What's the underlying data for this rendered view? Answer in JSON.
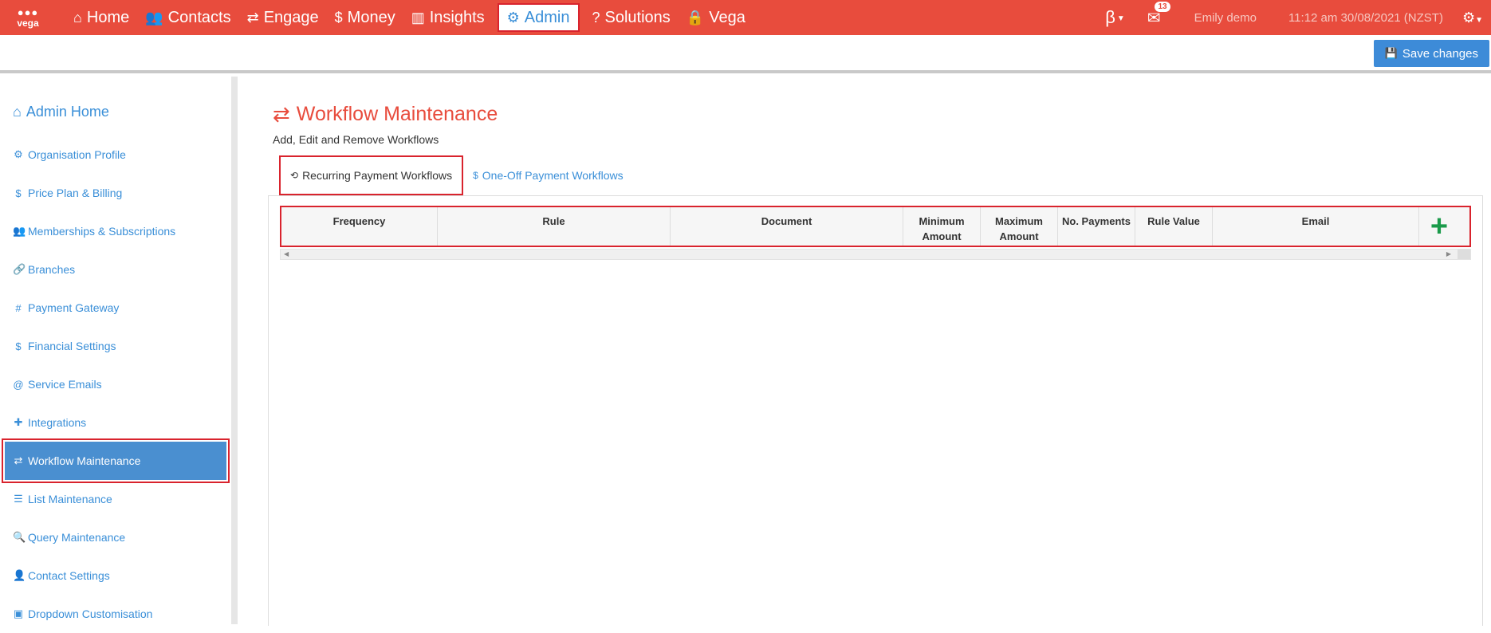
{
  "brand": {
    "logo_text": "vega",
    "colors": {
      "primary": "#e84c3d",
      "accent": "#3a8fd8",
      "add": "#1a9a4a"
    }
  },
  "nav": [
    {
      "icon": "home-icon",
      "glyph": "⌂",
      "label": "Home"
    },
    {
      "icon": "contacts-icon",
      "glyph": "👥",
      "label": "Contacts"
    },
    {
      "icon": "engage-icon",
      "glyph": "⇄",
      "label": "Engage"
    },
    {
      "icon": "dollar-icon",
      "glyph": "$",
      "label": "Money"
    },
    {
      "icon": "chart-icon",
      "glyph": "▥",
      "label": "Insights"
    },
    {
      "icon": "gears-icon",
      "glyph": "⚙",
      "label": "Admin"
    },
    {
      "icon": "help-icon",
      "glyph": "?",
      "label": "Solutions"
    },
    {
      "icon": "lock-icon",
      "glyph": "🔒",
      "label": "Vega"
    }
  ],
  "topright": {
    "beta": "β",
    "mail_count": "13",
    "user": "Emily demo",
    "datetime": "11:12 am 30/08/2021 (NZST)"
  },
  "toolbar": {
    "save_label": "Save changes"
  },
  "sidebar": {
    "home_label": "Admin Home",
    "items": [
      {
        "glyph": "⚙",
        "label": "Organisation Profile"
      },
      {
        "glyph": "$",
        "label": "Price Plan & Billing"
      },
      {
        "glyph": "👥",
        "label": "Memberships & Subscriptions"
      },
      {
        "glyph": "🔗",
        "label": "Branches"
      },
      {
        "glyph": "#",
        "label": "Payment Gateway"
      },
      {
        "glyph": "$",
        "label": "Financial Settings"
      },
      {
        "glyph": "@",
        "label": "Service Emails"
      },
      {
        "glyph": "✚",
        "label": "Integrations"
      },
      {
        "glyph": "⇄",
        "label": "Workflow Maintenance"
      },
      {
        "glyph": "☰",
        "label": "List Maintenance"
      },
      {
        "glyph": "🔍",
        "label": "Query Maintenance"
      },
      {
        "glyph": "👤",
        "label": "Contact Settings"
      },
      {
        "glyph": "▣",
        "label": "Dropdown Customisation"
      }
    ]
  },
  "main": {
    "title": "Workflow Maintenance",
    "subtitle": "Add, Edit and Remove Workflows",
    "tabs": {
      "recurring": "Recurring Payment Workflows",
      "oneoff": "One-Off Payment Workflows"
    },
    "columns": [
      "Frequency",
      "Rule",
      "Document",
      "Minimum Amount",
      "Maximum Amount",
      "No. Payments",
      "Rule Value",
      "Email"
    ]
  }
}
